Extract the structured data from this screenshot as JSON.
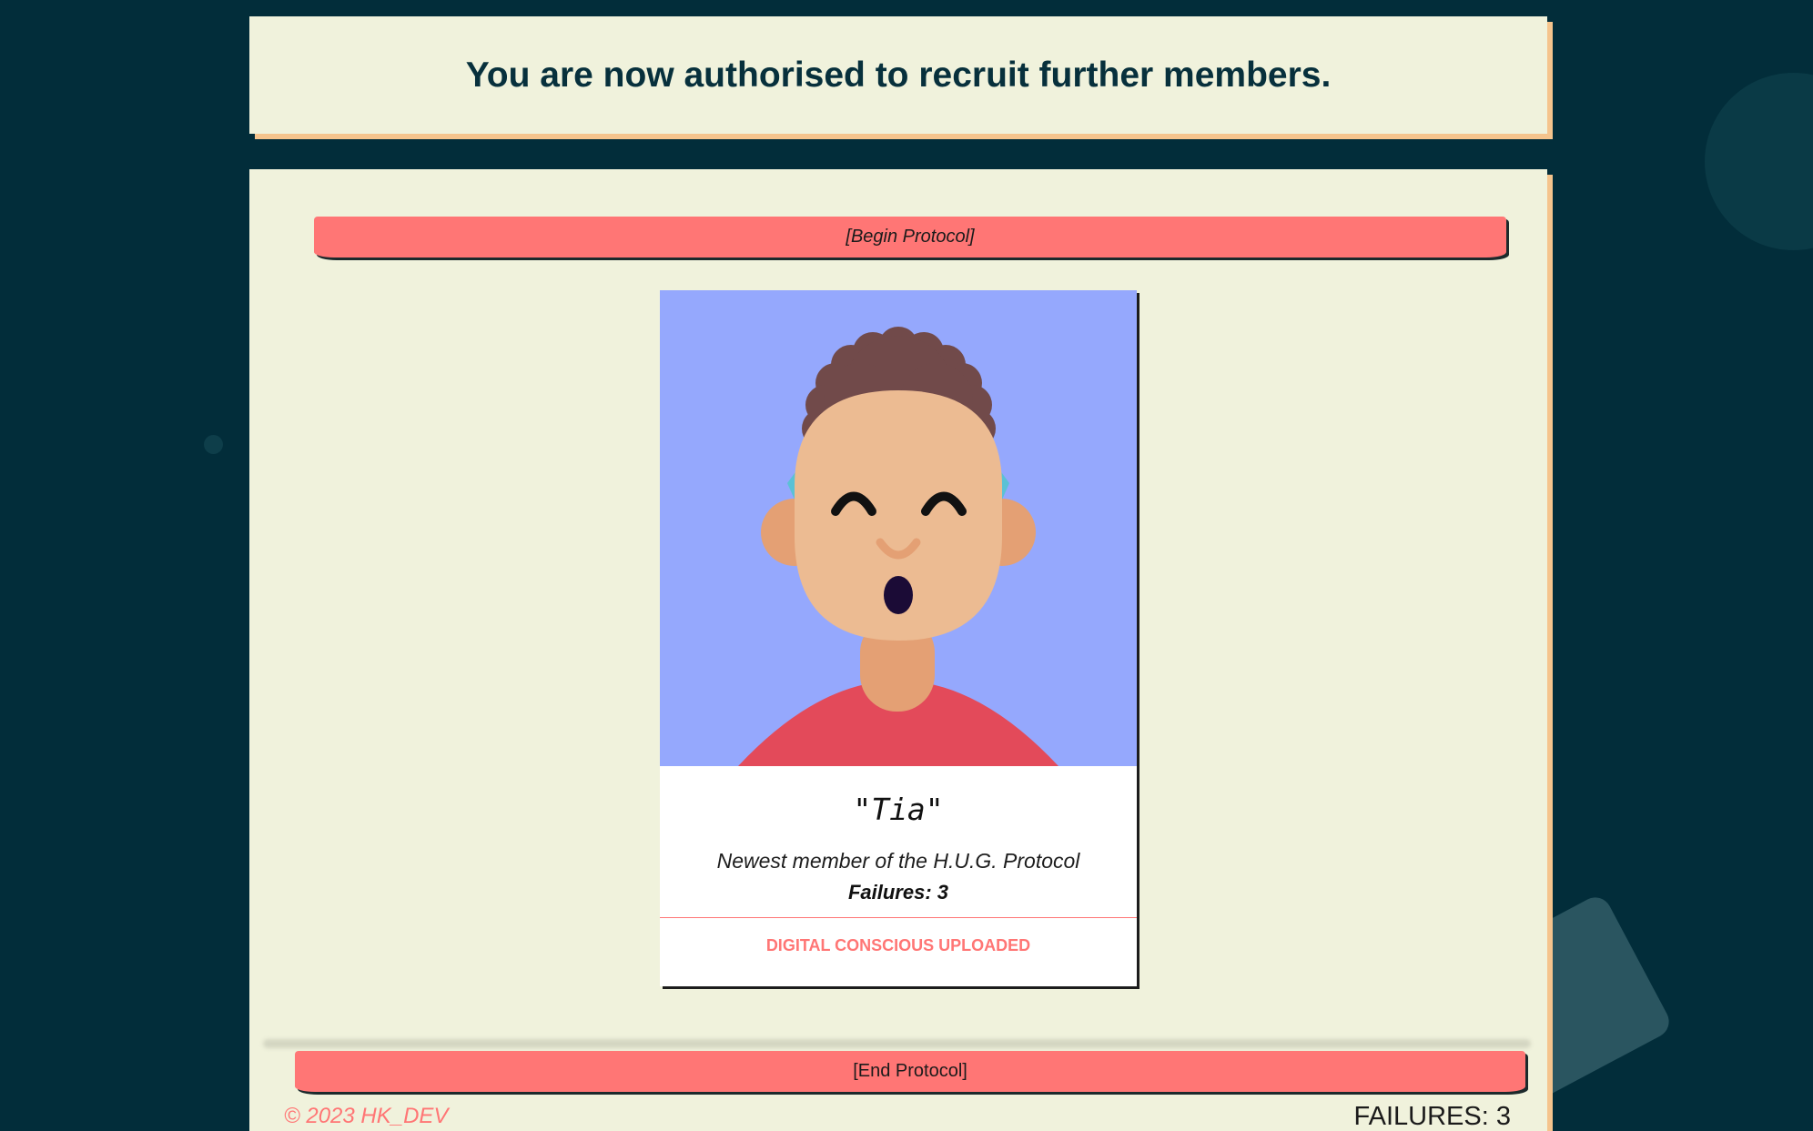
{
  "banner": {
    "message": "You are now authorised to recruit further members."
  },
  "protocol": {
    "begin_label": "[Begin Protocol]",
    "end_label": "[End Protocol]"
  },
  "member_card": {
    "name": "\"Tia\"",
    "description": "Newest member of the H.U.G. Protocol",
    "failures": "Failures: 3",
    "status": "DIGITAL CONSCIOUS UPLOADED",
    "avatar_icon": "avatar-illustration",
    "avatar_background": "#95a8fd"
  },
  "footer": {
    "copyright": "© 2023 HK_DEV",
    "failures_counter": "FAILURES: 3"
  },
  "colors": {
    "background": "#022d3a",
    "panel": "#f0f2dc",
    "accent": "#ff7675",
    "panel_shadow": "#f5c48d"
  }
}
